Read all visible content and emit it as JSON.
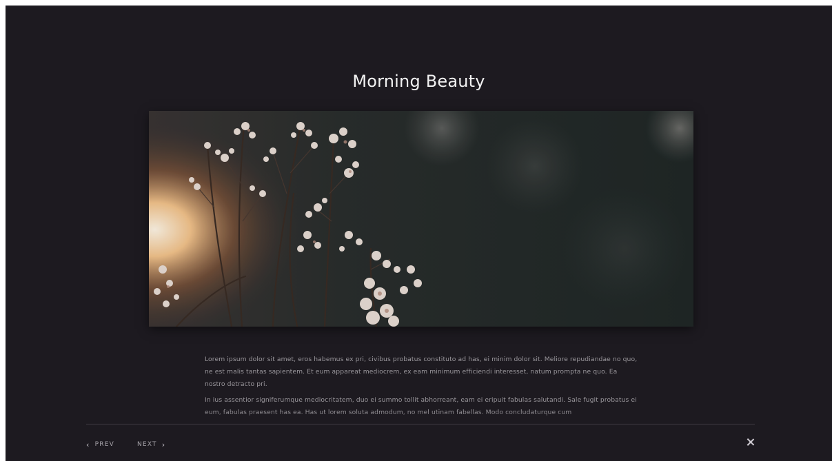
{
  "post": {
    "title": "Morning Beauty",
    "image_icon": "photo-icon",
    "paragraphs": [
      "Lorem ipsum dolor sit amet, eros habemus ex pri, civibus probatus constituto ad has, ei minim dolor sit. Meliore repudiandae no quo, ne est malis tantas sapientem. Et eum appareat mediocrem, ex eam minimum efficiendi interesset, natum prompta ne quo. Ea nostro detracto pri.",
      "In ius assentior signiferumque mediocritatem, duo ei summo tollit abhorreant, eam ei eripuit fabulas salutandi. Sale fugit probatus ei eum, fabulas praesent has ea. Has ut lorem soluta admodum, no mel utinam fabellas. Modo concludaturque cum"
    ]
  },
  "footer": {
    "prev_label": "PREV",
    "next_label": "NEXT",
    "prev_icon": "chevron-left-icon",
    "next_icon": "chevron-right-icon",
    "close_icon": "close-icon"
  },
  "colors": {
    "background": "#1d1a20",
    "title": "#f2f2f2",
    "body_text": "#9a979c",
    "divider": "#3f3b43"
  }
}
